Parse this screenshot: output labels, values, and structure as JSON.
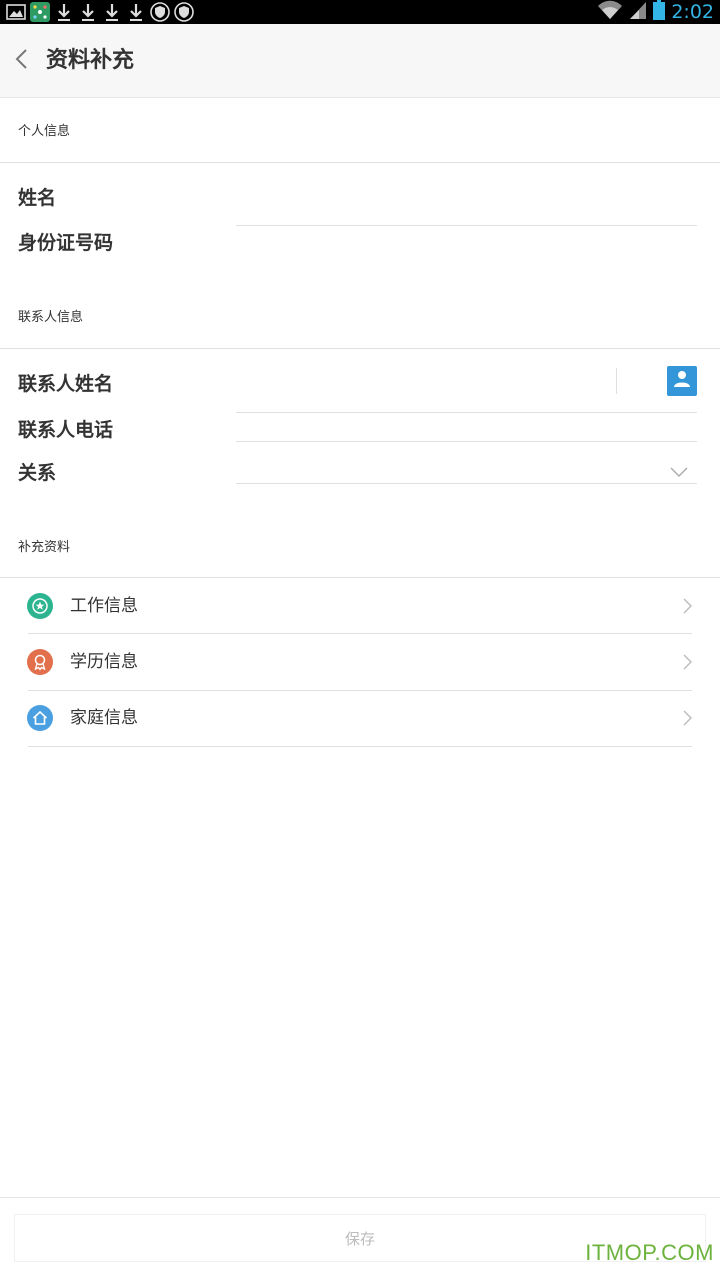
{
  "status_bar": {
    "time": "2:02",
    "colors": {
      "time": "#33b5e5",
      "background": "#000000"
    },
    "icons": [
      "image-icon",
      "app-icon",
      "download-icon",
      "download-icon",
      "download-icon",
      "download-icon",
      "shield-icon",
      "shield-icon",
      "wifi-icon",
      "signal-icon",
      "battery-icon"
    ]
  },
  "header": {
    "title": "资料补充",
    "back_icon": "chevron-left-icon"
  },
  "personal": {
    "heading": "个人信息",
    "name_label": "姓名",
    "id_label": "身份证号码"
  },
  "contact": {
    "heading": "联系人信息",
    "name_label": "联系人姓名",
    "phone_label": "联系人电话",
    "relation_label": "关系",
    "picker_icon": "contact-person-icon",
    "picker_color": "#3296d8"
  },
  "supplement": {
    "heading": "补充资料",
    "items": [
      {
        "label": "工作信息",
        "icon": "star-badge-icon",
        "color": "#2cb38f"
      },
      {
        "label": "学历信息",
        "icon": "award-icon",
        "color": "#e2704c"
      },
      {
        "label": "家庭信息",
        "icon": "home-icon",
        "color": "#4a9fe0"
      }
    ]
  },
  "footer": {
    "save_label": "保存"
  },
  "watermark": {
    "text": "ITMOP.COM",
    "color": "#6cb33e"
  }
}
